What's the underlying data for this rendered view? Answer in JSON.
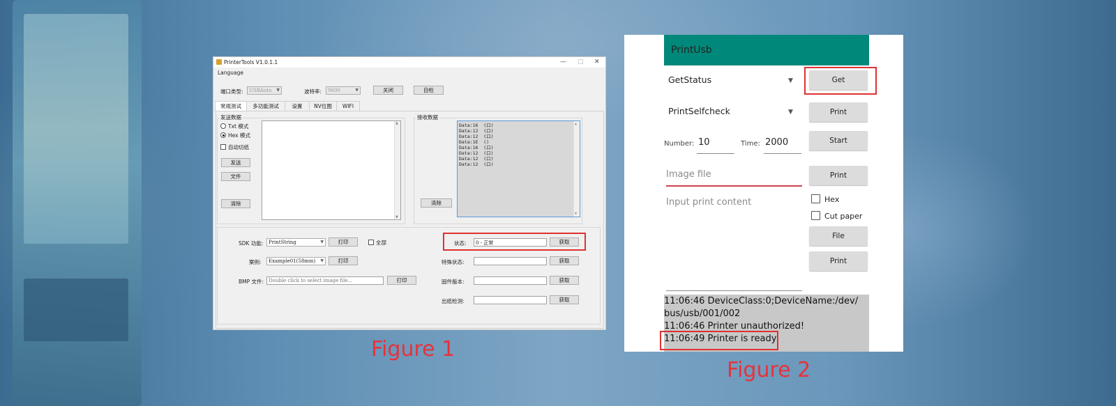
{
  "figure1": {
    "caption": "Figure 1",
    "window_title": "PrinterTools V1.0.1.1",
    "controls": {
      "minimize": "—",
      "maximize": "□",
      "close": "✕"
    },
    "menu": {
      "language": "Language"
    },
    "port": {
      "label": "端口类型:",
      "value": "USBAuto"
    },
    "baud": {
      "label": "波特率:",
      "value": "9600"
    },
    "buttons": {
      "close": "关闭",
      "selftest": "自检"
    },
    "tabs": [
      "常规测试",
      "多功能测试",
      "设置",
      "NV位图",
      "WIFI"
    ],
    "send": {
      "group_label": "发送数据",
      "txt_mode": "Txt 模式",
      "hex_mode": "Hex 模式",
      "auto_cut": "自动切纸",
      "send_button": "发送",
      "file_button": "文件",
      "clear_button": "清除"
    },
    "receive": {
      "group_label": "接收数据",
      "clear_button": "清除",
      "lines": [
        "Data:16  (口)",
        "Data:12  (口)",
        "Data:12  (口)",
        "Data:1E  ()",
        "Data:16  (口)",
        "Data:12  (口)",
        "Data:12  (口)",
        "Data:12  (口)"
      ]
    },
    "sdk": {
      "label": "SDK 功能:",
      "value": "PrintString",
      "print_button": "打印",
      "all_label": "全部"
    },
    "example": {
      "label": "案例:",
      "value": "Example01(58mm)",
      "print_button": "打印"
    },
    "bmp": {
      "label": "BMP 文件:",
      "placeholder": "Double click to select image file...",
      "print_button": "打印"
    },
    "status_rows": [
      {
        "label": "状态:",
        "value": "0 - 正常",
        "button": "获取"
      },
      {
        "label": "特殊状态:",
        "value": "",
        "button": "获取"
      },
      {
        "label": "固件版本:",
        "value": "",
        "button": "获取"
      },
      {
        "label": "出纸检测:",
        "value": "",
        "button": "获取"
      }
    ]
  },
  "figure2": {
    "caption": "Figure 2",
    "app_title": "PrintUsb",
    "status_spinner": "GetStatus",
    "selfcheck_spinner": "PrintSelfcheck",
    "get_button": "Get",
    "print_button_1": "Print",
    "number_label": "Number:",
    "number_value": "10",
    "time_label": "Time:",
    "time_value": "2000",
    "start_button": "Start",
    "image_file_hint": "Image file",
    "print_button_2": "Print",
    "hex_label": "Hex",
    "cut_paper_label": "Cut paper",
    "content_hint": "Input print content",
    "file_button": "File",
    "print_button_3": "Print",
    "log": [
      "11:06:46 DeviceClass:0;DeviceName:/dev/",
      "bus/usb/001/002",
      "11:06:46 Printer unauthorized!",
      "11:06:49 Printer is ready"
    ]
  }
}
